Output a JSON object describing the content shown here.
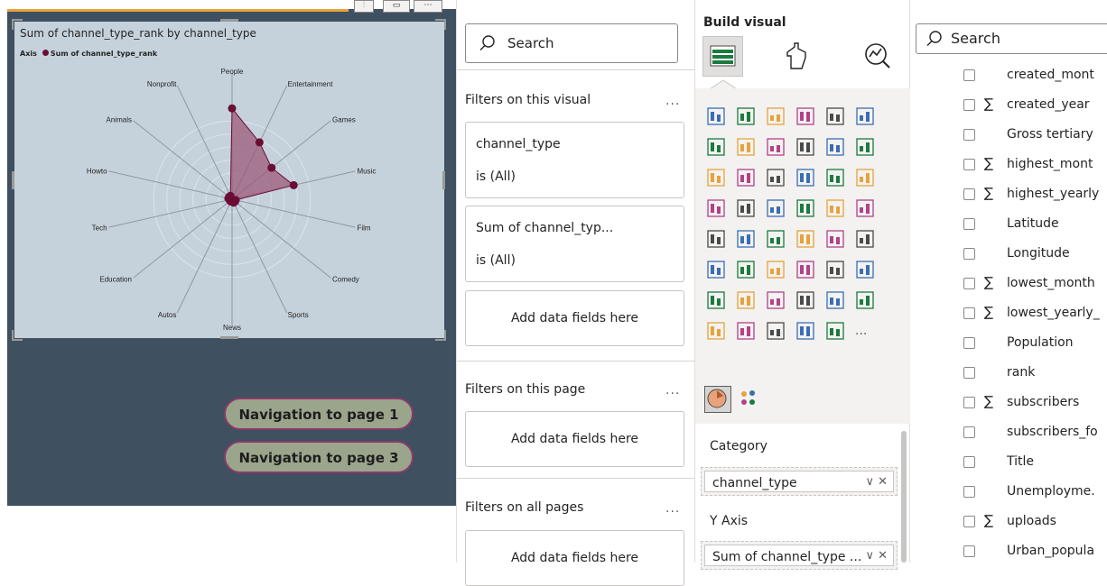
{
  "canvas": {
    "chart_title": "Sum of channel_type_rank by channel_type",
    "legend_label": "Axis",
    "legend_series": "Sum of channel_type_rank",
    "nav_buttons": [
      "Navigation to page 1",
      "Navigation to page 3"
    ]
  },
  "chart_data": {
    "type": "radar",
    "title": "Sum of channel_type_rank by channel_type",
    "legend": {
      "title": "Axis",
      "entries": [
        "Sum of channel_type_rank"
      ]
    },
    "categories": [
      "People",
      "Entertainment",
      "Games",
      "Music",
      "Film",
      "Comedy",
      "Sports",
      "News",
      "Autos",
      "Education",
      "Tech",
      "Howto",
      "Animals",
      "Nonprofit"
    ],
    "series": [
      {
        "name": "Sum of channel_type_rank",
        "values": [
          0.72,
          0.5,
          0.4,
          0.5,
          0.03,
          0.03,
          0.03,
          0.02,
          0.02,
          0.02,
          0.02,
          0.03,
          0.03,
          0.03
        ]
      }
    ],
    "colors": {
      "series": "#6b0d35",
      "fill": "#9b5a7a"
    }
  },
  "filters": {
    "search_placeholder": "Search",
    "visual_section": "Filters on this visual",
    "cards": [
      {
        "field": "channel_type",
        "state": "is (All)"
      },
      {
        "field": "Sum of channel_typ...",
        "state": "is (All)"
      }
    ],
    "add_fields": "Add data fields here",
    "page_section": "Filters on this page",
    "all_section": "Filters on all pages",
    "more": "..."
  },
  "build": {
    "title": "Build visual",
    "category_label": "Category",
    "category_field": "channel_type",
    "yaxis_label": "Y Axis",
    "yaxis_field": "Sum of channel_type ...",
    "well_controls": "∨ ✕",
    "more": "..."
  },
  "data_pane": {
    "search_placeholder": "Search",
    "fields": [
      {
        "name": "created_mont",
        "sigma": false
      },
      {
        "name": "created_year",
        "sigma": true
      },
      {
        "name": "Gross tertiary",
        "sigma": false
      },
      {
        "name": "highest_mont",
        "sigma": true
      },
      {
        "name": "highest_yearly",
        "sigma": true
      },
      {
        "name": "Latitude",
        "sigma": false
      },
      {
        "name": "Longitude",
        "sigma": false
      },
      {
        "name": "lowest_month",
        "sigma": true
      },
      {
        "name": "lowest_yearly_",
        "sigma": true
      },
      {
        "name": "Population",
        "sigma": false
      },
      {
        "name": "rank",
        "sigma": false
      },
      {
        "name": "subscribers",
        "sigma": true
      },
      {
        "name": "subscribers_fo",
        "sigma": false
      },
      {
        "name": "Title",
        "sigma": false
      },
      {
        "name": "Unemployme.",
        "sigma": false
      },
      {
        "name": "uploads",
        "sigma": true
      },
      {
        "name": "Urban_popula",
        "sigma": false
      }
    ]
  }
}
